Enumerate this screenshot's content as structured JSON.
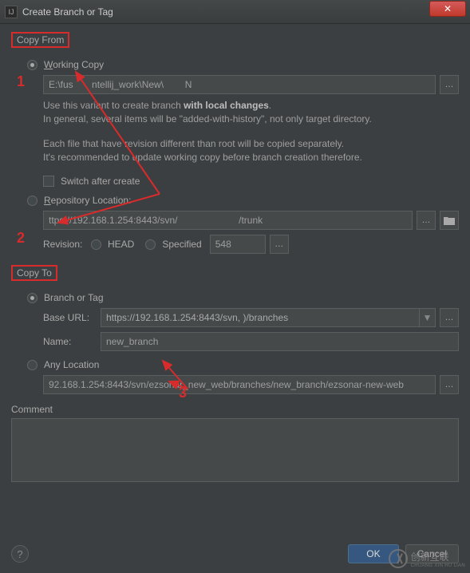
{
  "window": {
    "title": "Create Branch or Tag"
  },
  "copyFrom": {
    "groupLabel": "Copy From",
    "workingCopy": {
      "label_pre": "W",
      "label_rest": "orking Copy",
      "path": "E:\\fus       ntellij_work\\New\\        N"
    },
    "desc1_a": "Use this variant to create branch ",
    "desc1_b": "with local changes",
    "desc1_c": ".",
    "desc2": "In general, several items will be \"added-with-history\", not only target directory.",
    "desc3": "Each file that have revision different than root will be copied separately.",
    "desc4": "It's recommended to update working copy before branch creation therefore.",
    "switchAfter": "Switch after create",
    "repoLoc": {
      "label_pre": "R",
      "label_rest": "epository Location:",
      "url": "ttps://192.168.1.254:8443/svn/                       /trunk"
    },
    "revision": {
      "label": "Revision:",
      "head": "HEAD",
      "specified": "Specified",
      "value": "548"
    }
  },
  "copyTo": {
    "groupLabel": "Copy To",
    "branchOrTag": {
      "label": "Branch or Tag",
      "baseUrlLabel": "Base URL:",
      "baseUrl": "https://192.168.1.254:8443/svn,                        )/branches",
      "nameLabel": "Name:",
      "name": "new_branch"
    },
    "anyLocation": {
      "label": "Any Location",
      "url": "92.168.1.254:8443/svn/ezsonar_new_web/branches/new_branch/ezsonar-new-web"
    }
  },
  "commentLabel": "Comment",
  "buttons": {
    "ok": "OK",
    "cancel": "Cancel"
  },
  "annotations": {
    "n1": "1",
    "n2": "2",
    "n3": "3"
  },
  "watermark": {
    "line1": "创新互联",
    "line2": "CHUANG XIN HU LIAN"
  }
}
